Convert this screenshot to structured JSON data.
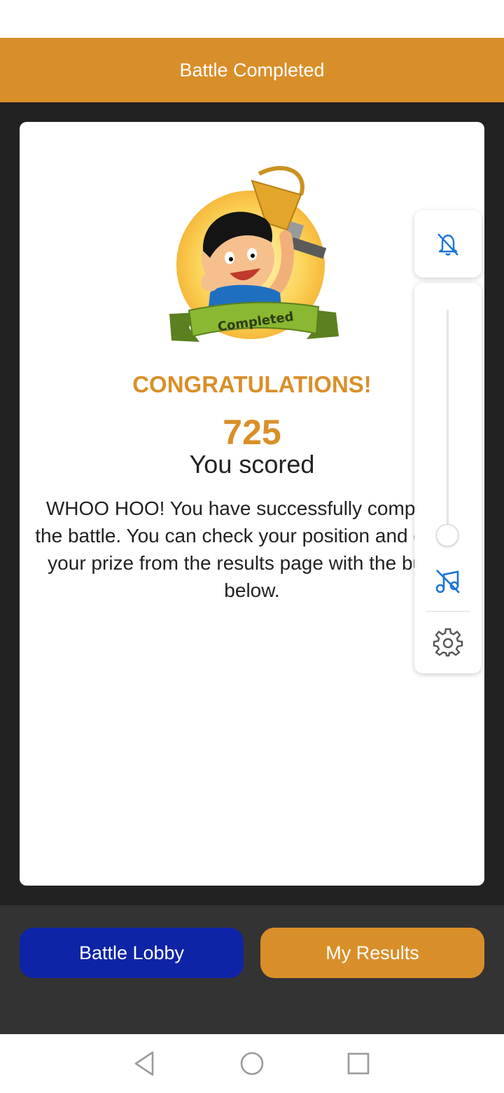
{
  "header": {
    "title": "Battle Completed"
  },
  "result": {
    "badge_text": "Completed",
    "congrats": "CONGRATULATIONS!",
    "score": "725",
    "score_label": "You scored",
    "message": "WHOO HOO! You have successfully completed the battle. You can check your position and collect your prize from the results page with the button below."
  },
  "controls": {
    "notifications_icon": "bell-off-icon",
    "volume_level": 0.0,
    "music_icon": "music-off-icon",
    "settings_icon": "gear-icon"
  },
  "actions": {
    "lobby_label": "Battle Lobby",
    "results_label": "My Results"
  },
  "nav": {
    "back_icon": "back-triangle-icon",
    "home_icon": "home-circle-icon",
    "recents_icon": "recents-square-icon"
  },
  "colors": {
    "accent": "#d98f29",
    "lobby": "#0e24a6",
    "dark_bg": "#222222",
    "control_blue": "#1a73d9"
  }
}
